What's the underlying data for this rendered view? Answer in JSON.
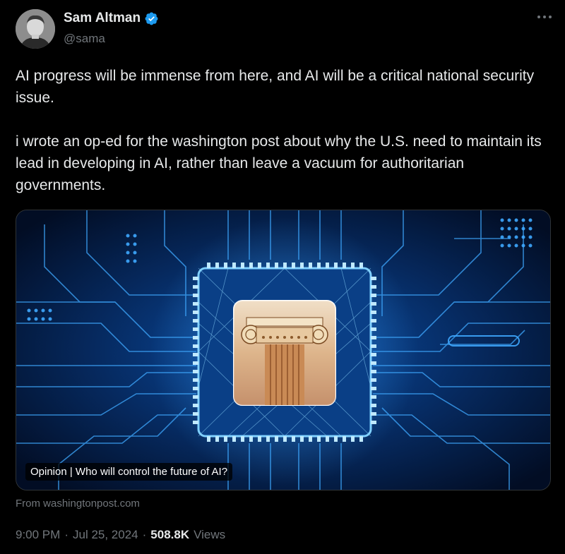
{
  "author": {
    "display_name": "Sam Altman",
    "handle": "@sama",
    "verified": true,
    "verified_color": "#1d9bf0"
  },
  "tweet": {
    "paragraphs": [
      "AI progress will be immense from here, and AI will be a critical national security issue.",
      "i wrote an op-ed for the washington post about why the U.S. need to maintain its lead in developing in AI, rather than leave a vacuum for authoritarian governments."
    ]
  },
  "card": {
    "caption": "Opinion | Who will control the future of AI?",
    "source": "From washingtonpost.com",
    "image_icon": "circuit-chip-with-ionic-column"
  },
  "meta": {
    "time": "9:00 PM",
    "date": "Jul 25, 2024",
    "views_count": "508.8K",
    "views_label": "Views",
    "separator": "·"
  },
  "icons": {
    "more": "more-dots-icon",
    "verified": "verified-badge-icon"
  },
  "colors": {
    "background": "#000000",
    "text": "#e7e9ea",
    "secondary": "#71767b",
    "circuit": "#3fa9ff"
  }
}
